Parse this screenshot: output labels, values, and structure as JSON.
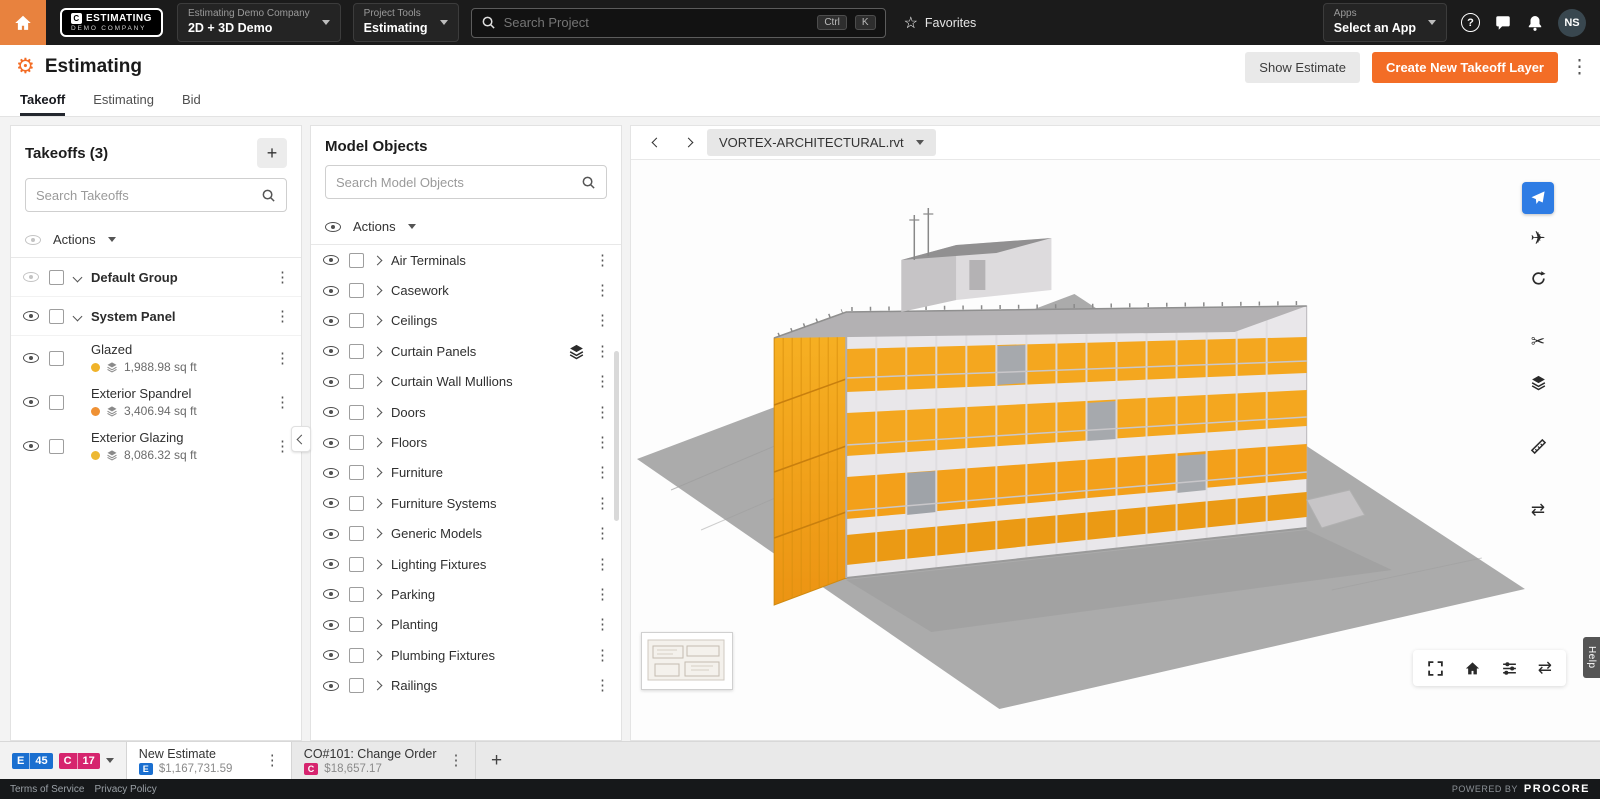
{
  "topbar": {
    "logo_mark": "C",
    "logo_line1": "ESTIMATING",
    "logo_line2": "DEMO COMPANY",
    "company_selector": {
      "label": "Estimating Demo Company",
      "value": "2D + 3D Demo"
    },
    "tools_selector": {
      "label": "Project Tools",
      "value": "Estimating"
    },
    "search": {
      "placeholder": "Search Project",
      "shortcut_keys": [
        "Ctrl",
        "K"
      ]
    },
    "favorites_label": "Favorites",
    "apps": {
      "label": "Apps",
      "value": "Select an App"
    },
    "avatar_initials": "NS"
  },
  "app_header": {
    "title": "Estimating",
    "show_estimate_label": "Show Estimate",
    "create_button_label": "Create New Takeoff Layer"
  },
  "tabs": [
    {
      "label": "Takeoff"
    },
    {
      "label": "Estimating"
    },
    {
      "label": "Bid"
    }
  ],
  "takeoffs_panel": {
    "title": "Takeoffs (3)",
    "search_placeholder": "Search Takeoffs",
    "actions_label": "Actions",
    "groups": [
      {
        "label": "Default Group"
      },
      {
        "label": "System Panel"
      }
    ],
    "items": [
      {
        "label": "Glazed",
        "quantity": "1,988.98 sq ft",
        "dot_color": "#f0b32a"
      },
      {
        "label": "Exterior Spandrel",
        "quantity": "3,406.94 sq ft",
        "dot_color": "#ef9134"
      },
      {
        "label": "Exterior Glazing",
        "quantity": "8,086.32 sq ft",
        "dot_color": "#edb832"
      }
    ]
  },
  "model_objects_panel": {
    "title": "Model Objects",
    "search_placeholder": "Search Model Objects",
    "actions_label": "Actions",
    "items": [
      "Air Terminals",
      "Casework",
      "Ceilings",
      "Curtain Panels",
      "Curtain Wall Mullions",
      "Doors",
      "Floors",
      "Furniture",
      "Furniture Systems",
      "Generic Models",
      "Lighting Fixtures",
      "Parking",
      "Planting",
      "Plumbing Fixtures",
      "Railings"
    ]
  },
  "viewer": {
    "model_selector": "VORTEX-ARCHITECTURAL.rvt",
    "help_tab": "Help"
  },
  "bottom_bar": {
    "badges": [
      {
        "letter": "E",
        "count": "45",
        "color": "#1a6fd0"
      },
      {
        "letter": "C",
        "count": "17",
        "color": "#d6246e"
      }
    ],
    "tabs": [
      {
        "letter": "E",
        "badge_color": "#1a6fd0",
        "name": "New Estimate",
        "amount": "$1,167,731.59"
      },
      {
        "letter": "C",
        "badge_color": "#d6246e",
        "name": "CO#101: Change Order",
        "amount": "$18,657.17"
      }
    ]
  },
  "footer": {
    "links": [
      "Terms of Service",
      "Privacy Policy"
    ],
    "powered_by": "POWERED BY",
    "brand": "PROCORE"
  },
  "colors": {
    "accent_orange": "#f36d26",
    "active_tool_blue": "#2e7ce4"
  }
}
